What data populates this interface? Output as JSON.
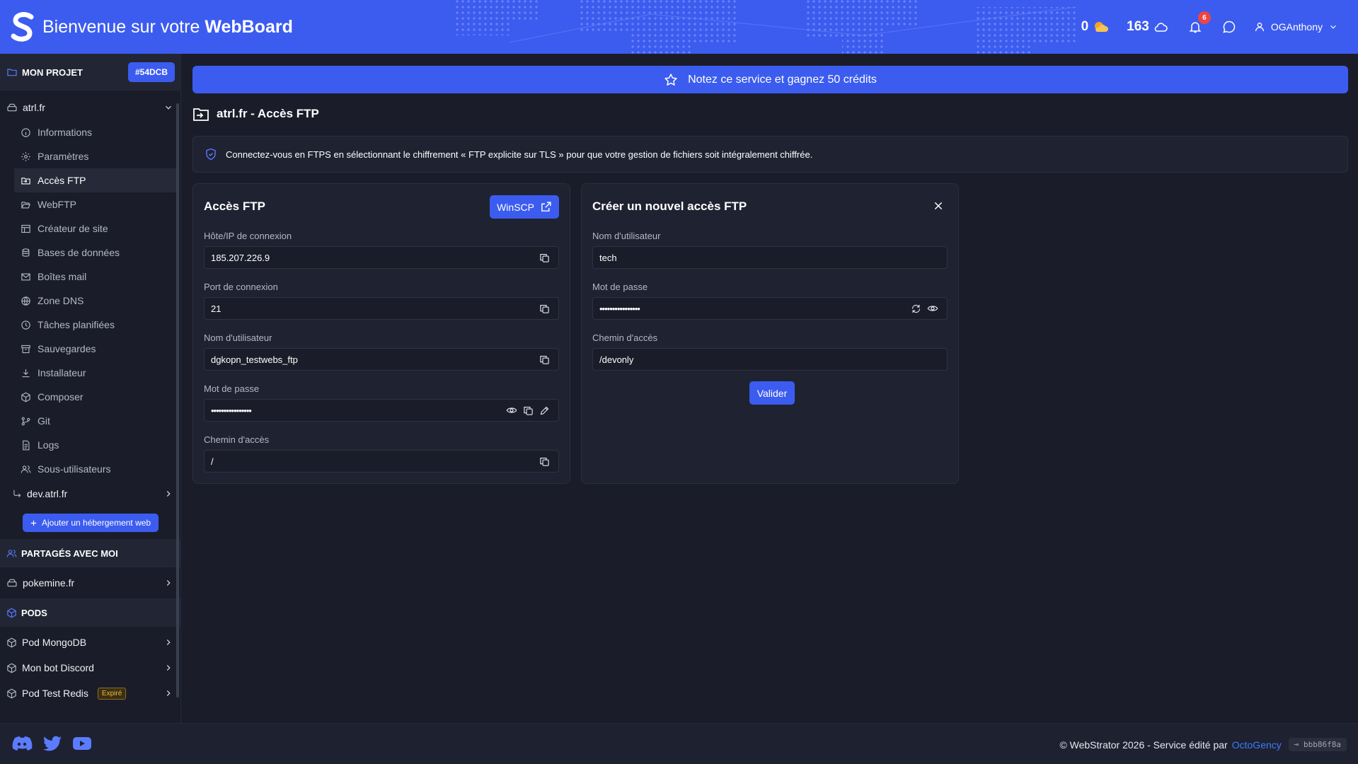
{
  "header": {
    "welcome_prefix": "Bienvenue sur votre",
    "welcome_brand": "WebBoard",
    "credits_count": "0",
    "cloud_count": "163",
    "notification_count": "6",
    "username": "OGAnthony",
    "accent_color": "#3c5cf0"
  },
  "sidebar": {
    "project_section": {
      "label": "MON PROJET",
      "project_id": "#54DCB"
    },
    "domain": "atrl.fr",
    "items": [
      {
        "label": "Informations",
        "icon": "info-icon"
      },
      {
        "label": "Paramètres",
        "icon": "gear-icon"
      },
      {
        "label": "Accès FTP",
        "icon": "folder-login-icon",
        "active": true
      },
      {
        "label": "WebFTP",
        "icon": "folder-open-icon"
      },
      {
        "label": "Créateur de site",
        "icon": "layout-icon"
      },
      {
        "label": "Bases de données",
        "icon": "database-icon"
      },
      {
        "label": "Boîtes mail",
        "icon": "mail-icon"
      },
      {
        "label": "Zone DNS",
        "icon": "globe-icon"
      },
      {
        "label": "Tâches planifiées",
        "icon": "clock-icon"
      },
      {
        "label": "Sauvegardes",
        "icon": "archive-icon"
      },
      {
        "label": "Installateur",
        "icon": "download-icon"
      },
      {
        "label": "Composer",
        "icon": "package-icon"
      },
      {
        "label": "Git",
        "icon": "git-icon"
      },
      {
        "label": "Logs",
        "icon": "file-text-icon"
      },
      {
        "label": "Sous-utilisateurs",
        "icon": "users-icon"
      }
    ],
    "subdomain": "dev.atrl.fr",
    "add_hosting_label": "Ajouter un hébergement web",
    "shared_section": {
      "label": "PARTAGÉS AVEC MOI"
    },
    "shared_items": [
      {
        "label": "pokemine.fr"
      }
    ],
    "pods_section": {
      "label": "PODS"
    },
    "pods": [
      {
        "label": "Pod MongoDB",
        "badge": ""
      },
      {
        "label": "Mon bot Discord",
        "badge": ""
      },
      {
        "label": "Pod Test Redis",
        "badge": "Expiré"
      }
    ]
  },
  "banner": {
    "text": "Notez ce service et gagnez 50 crédits"
  },
  "page": {
    "title": "atrl.fr - Accès FTP",
    "info": "Connectez-vous en FTPS en sélectionnant le chiffrement « FTP explicite sur TLS » pour que votre gestion de fichiers soit intégralement chiffrée."
  },
  "ftp_card": {
    "title": "Accès FTP",
    "winscp_label": "WinSCP",
    "fields": [
      {
        "label": "Hôte/IP de connexion",
        "value": "185.207.226.9"
      },
      {
        "label": "Port de connexion",
        "value": "21"
      },
      {
        "label": "Nom d'utilisateur",
        "value": "dgkopn_testwebs_ftp"
      },
      {
        "label": "Mot de passe",
        "value": "••••••••••••••••"
      },
      {
        "label": "Chemin d'accès",
        "value": "/"
      }
    ]
  },
  "new_ftp_card": {
    "title": "Créer un nouvel accès FTP",
    "fields": [
      {
        "label": "Nom d'utilisateur",
        "value": "tech"
      },
      {
        "label": "Mot de passe",
        "value": "••••••••••••••••"
      },
      {
        "label": "Chemin d'accès",
        "value": "/devonly"
      }
    ],
    "submit_label": "Valider"
  },
  "footer": {
    "copyright_text": "© WebStrator 2026 - Service édité par",
    "publisher": "OctoGency",
    "commit_hash": "bbb86f8a"
  }
}
